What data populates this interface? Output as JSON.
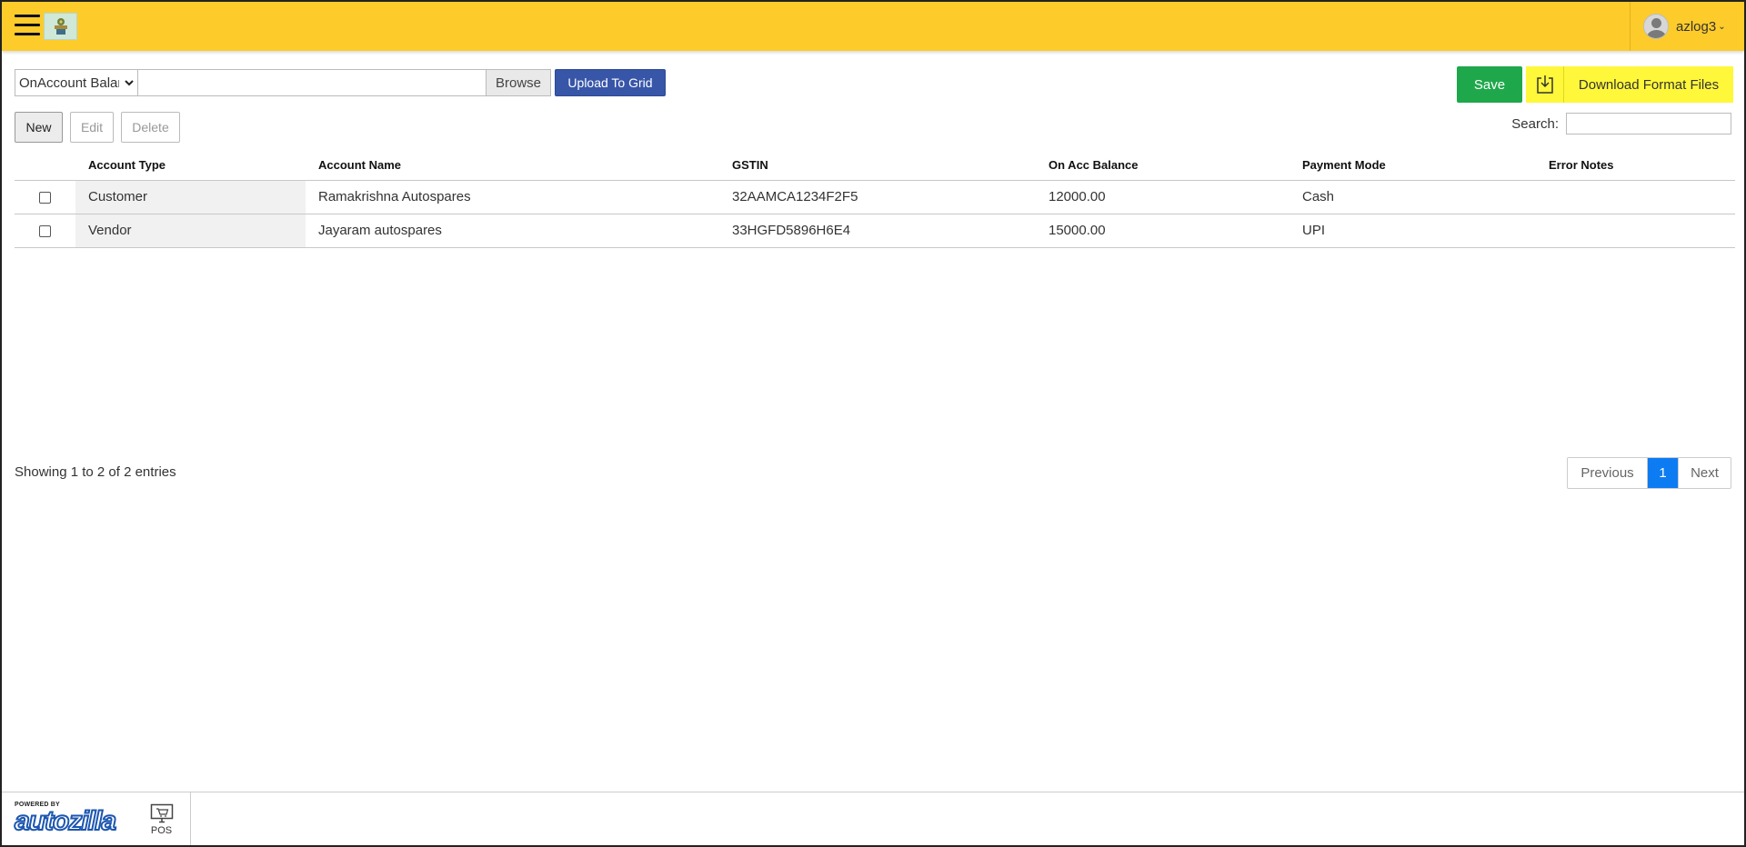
{
  "header": {
    "menu_icon": "hamburger-icon",
    "logo_icon": "company-logo",
    "username": "azlog3",
    "chevron": "⌄"
  },
  "upload": {
    "selected_type": "OnAccount Balance",
    "file_value": "",
    "browse_label": "Browse",
    "upload_label": "Upload To Grid"
  },
  "actions": {
    "save_label": "Save",
    "download_label": "Download Format Files"
  },
  "toolbar": {
    "new_label": "New",
    "edit_label": "Edit",
    "delete_label": "Delete"
  },
  "search": {
    "label": "Search:",
    "value": ""
  },
  "table": {
    "columns": [
      "Account Type",
      "Account Name",
      "GSTIN",
      "On Acc Balance",
      "Payment Mode",
      "Error Notes"
    ],
    "rows": [
      {
        "account_type": "Customer",
        "account_name": "Ramakrishna Autospares",
        "gstin": "32AAMCA1234F2F5",
        "balance": "12000.00",
        "payment_mode": "Cash",
        "error_notes": ""
      },
      {
        "account_type": "Vendor",
        "account_name": "Jayaram autospares",
        "gstin": "33HGFD5896H6E4",
        "balance": "15000.00",
        "payment_mode": "UPI",
        "error_notes": ""
      }
    ]
  },
  "info": {
    "text": "Showing 1 to 2 of 2 entries"
  },
  "pagination": {
    "previous": "Previous",
    "current": "1",
    "next": "Next"
  },
  "footer": {
    "powered_by": "POWERED BY",
    "brand": "autozilla",
    "pos_label": "POS"
  },
  "colors": {
    "header": "#fdcb2a",
    "save": "#1fa84b",
    "download": "#fff73a",
    "upload": "#3856a8",
    "page_active": "#0d7cf2"
  }
}
